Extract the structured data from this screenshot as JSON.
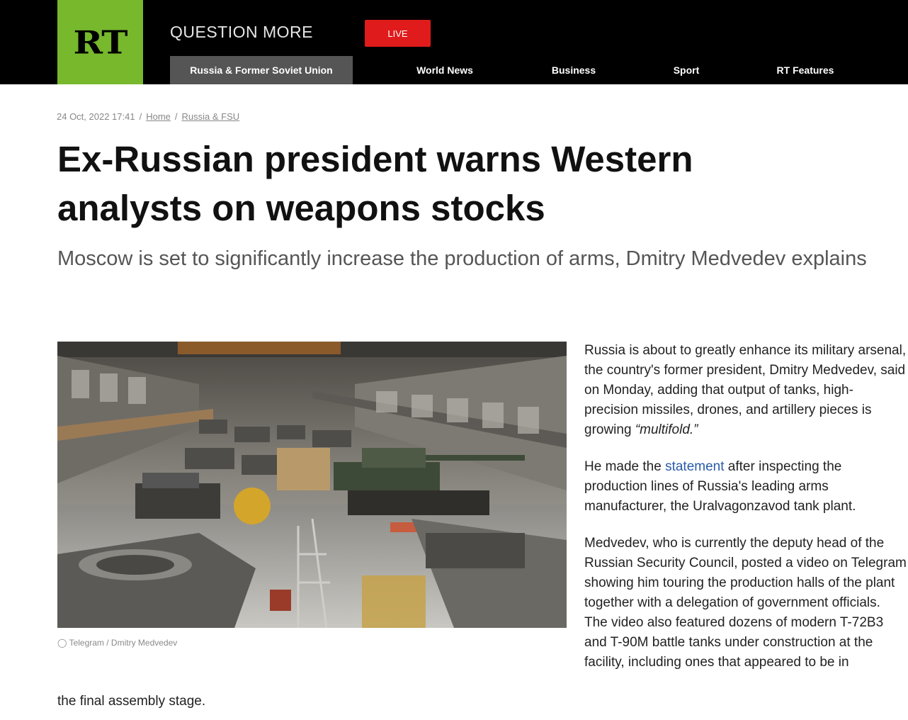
{
  "header": {
    "logo_text": "RT",
    "tagline": "QUESTION MORE",
    "live_label": "LIVE",
    "nav": [
      {
        "label": "Russia & Former Soviet Union",
        "active": true
      },
      {
        "label": "World News",
        "active": false
      },
      {
        "label": "Business",
        "active": false
      },
      {
        "label": "Sport",
        "active": false
      },
      {
        "label": "RT Features",
        "active": false
      }
    ]
  },
  "breadcrumb": {
    "date": "24 Oct, 2022 17:41",
    "sep": "/",
    "home": "Home",
    "section": "Russia & FSU"
  },
  "article": {
    "title": "Ex-Russian president warns Western analysts on weapons stocks",
    "subtitle": "Moscow is set to significantly increase the production of arms, Dmitry Medvedev explains",
    "image_caption": "Telegram / Dmitry Medvedev",
    "p1": "Russia is about to greatly enhance its military arsenal, the country's former president, Dmitry Medvedev, said on Monday, adding that output of tanks, high-precision missiles, drones, and artillery pieces is growing",
    "p1_em": "“multifold.”",
    "p2_before": "He made the",
    "p2_link": "statement",
    "p2_after": "after inspecting the production lines of Russia's leading arms manufacturer, the Uralvagonzavod tank plant.",
    "p3": "Medvedev, who is currently the deputy head of the Russian Security Council, posted a video on Telegram showing him touring the production halls of the plant together with a delegation of government officials. The video also featured dozens of modern T-72B3 and T-90M battle tanks under construction at the facility, including ones that appeared to be in",
    "p3_tail": "the final assembly stage."
  },
  "colors": {
    "logo_green": "#77b82d",
    "live_red": "#e01b1b",
    "link_blue": "#2a5ba8"
  }
}
